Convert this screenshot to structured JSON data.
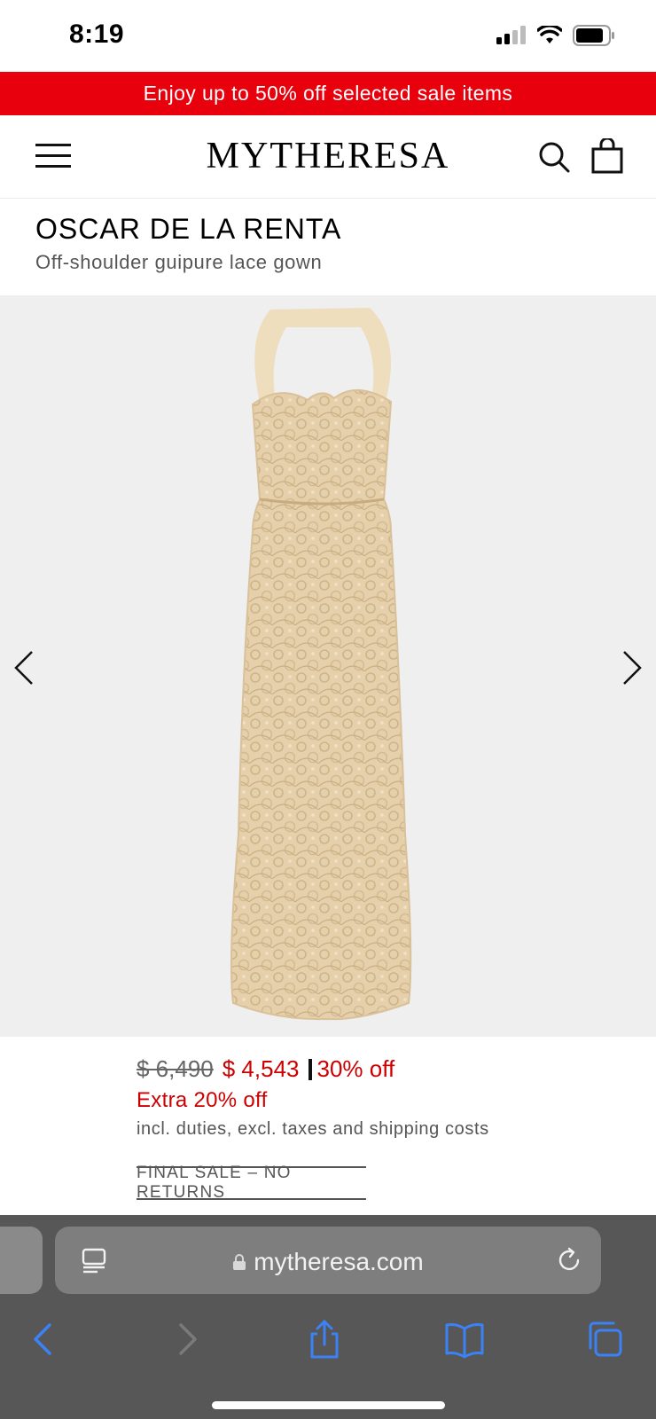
{
  "status_bar": {
    "time": "8:19"
  },
  "promo": {
    "text": "Enjoy up to 50% off selected sale items"
  },
  "header": {
    "logo": "MYTHERESA"
  },
  "product": {
    "brand": "OSCAR DE LA RENTA",
    "name": "Off-shoulder guipure lace gown"
  },
  "price": {
    "original": "$ 6,490",
    "sale": "$ 4,543",
    "discount": "30% off",
    "extra": "Extra 20% off",
    "note": "incl. duties, excl. taxes and shipping costs",
    "final_sale": "FINAL SALE – NO RETURNS"
  },
  "browser": {
    "url": "mytheresa.com"
  },
  "colors": {
    "promo_bg": "#e8000d",
    "sale_red": "#cc0000",
    "browser_bg": "#575757",
    "toolbar_blue": "#3b82f6"
  },
  "icons": {
    "menu": "menu-icon",
    "search": "search-icon",
    "bag": "shopping-bag-icon",
    "prev": "chevron-left-icon",
    "next": "chevron-right-icon"
  }
}
